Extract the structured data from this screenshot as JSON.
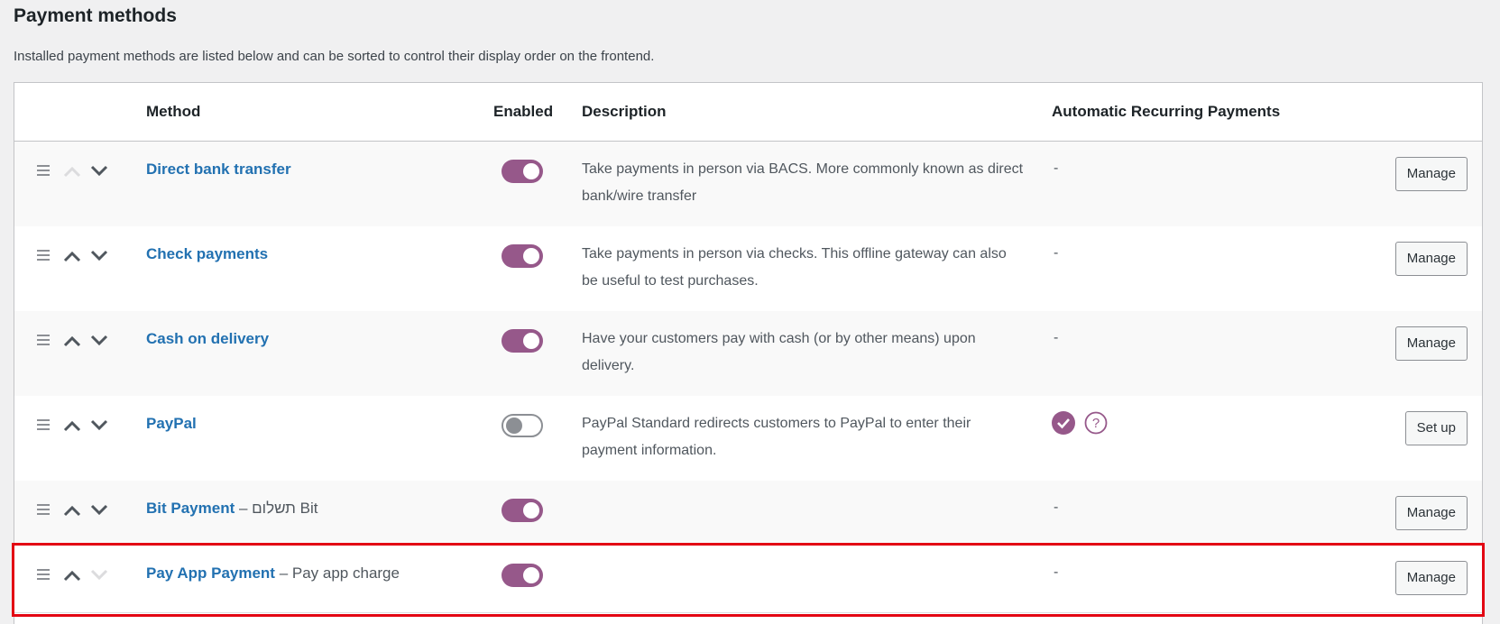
{
  "page": {
    "title": "Payment methods",
    "intro": "Installed payment methods are listed below and can be sorted to control their display order on the frontend."
  },
  "table": {
    "headers": {
      "method": "Method",
      "enabled": "Enabled",
      "description": "Description",
      "recurring": "Automatic Recurring Payments"
    },
    "rows": [
      {
        "name": "Direct bank transfer",
        "subtitle": "",
        "enabled": true,
        "description": "Take payments in person via BACS. More commonly known as direct bank/wire transfer",
        "recurring": "-",
        "action": "Manage",
        "up_disabled": true,
        "down_disabled": false
      },
      {
        "name": "Check payments",
        "subtitle": "",
        "enabled": true,
        "description": "Take payments in person via checks. This offline gateway can also be useful to test purchases.",
        "recurring": "-",
        "action": "Manage",
        "up_disabled": false,
        "down_disabled": false
      },
      {
        "name": "Cash on delivery",
        "subtitle": "",
        "enabled": true,
        "description": "Have your customers pay with cash (or by other means) upon delivery.",
        "recurring": "-",
        "action": "Manage",
        "up_disabled": false,
        "down_disabled": false
      },
      {
        "name": "PayPal",
        "subtitle": "",
        "enabled": false,
        "description": "PayPal Standard redirects customers to PayPal to enter their payment information.",
        "recurring": "",
        "recurring_icons": [
          "check-circle-icon",
          "help-icon"
        ],
        "action": "Set up",
        "up_disabled": false,
        "down_disabled": false
      },
      {
        "name": "Bit Payment",
        "subtitle": " – תשלום Bit",
        "enabled": true,
        "description": "",
        "recurring": "-",
        "action": "Manage",
        "up_disabled": false,
        "down_disabled": false
      },
      {
        "name": "Pay App Payment",
        "subtitle": " – Pay app charge",
        "enabled": true,
        "description": "",
        "recurring": "-",
        "action": "Manage",
        "up_disabled": false,
        "down_disabled": true
      }
    ]
  },
  "colors": {
    "accent": "#96588a",
    "link": "#2271b1",
    "highlight": "#e30613"
  }
}
